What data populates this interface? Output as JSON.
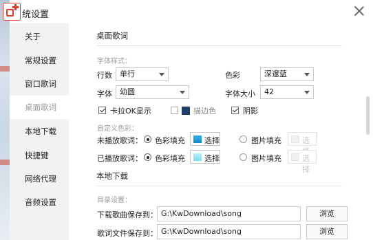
{
  "window": {
    "title": "统设置",
    "colors": {
      "accent": "#e23b2a",
      "sidebar_bg": "#f2f2f2",
      "swatch_deep_blue": "#1e3f6b",
      "fill_played_swatch": "#8fe3f2",
      "fill_unplayed_swatch": "#1c9bd7"
    }
  },
  "sidebar": {
    "items": [
      {
        "label": "关于"
      },
      {
        "label": "常规设置"
      },
      {
        "label": "窗口歌词"
      },
      {
        "label": "桌面歌词"
      },
      {
        "label": "本地下载"
      },
      {
        "label": "快捷键"
      },
      {
        "label": "网络代理"
      },
      {
        "label": "音频设置"
      }
    ],
    "active_index": 3
  },
  "desktop_lyrics": {
    "section_title": "桌面歌词",
    "font_style_label": "字体样式：",
    "lines_label": "行数",
    "lines_value": "单行",
    "color_label": "色彩",
    "color_value": "深邃蓝",
    "font_label": "字体",
    "font_value": "幼圆",
    "font_size_label": "字体大小",
    "font_size_value": "42",
    "karaoke_label": "卡拉OK显示",
    "karaoke_checked": true,
    "stroke_label": "描边色",
    "stroke_checked": false,
    "shadow_label": "阴影",
    "shadow_checked": true,
    "custom_color_label": "自定义色彩：",
    "unplayed_label": "未播放歌词：",
    "played_label": "已播放歌词：",
    "color_fill_label": "色彩填充",
    "image_fill_label": "图片填充",
    "select_label": "选择"
  },
  "local_download": {
    "section_title": "本地下载",
    "dir_label": "目录设置：",
    "song_path_label": "下载歌曲保存到：",
    "song_path_value": "G:\\KwDownload\\song",
    "lyric_path_label": "歌词文件保存到：",
    "lyric_path_value": "G:\\KwDownload\\song",
    "browse_label": "浏览"
  },
  "icons": [
    "app-logo-icon",
    "close-icon",
    "dropdown-arrow-icon",
    "checkbox-icon",
    "radio-icon"
  ]
}
